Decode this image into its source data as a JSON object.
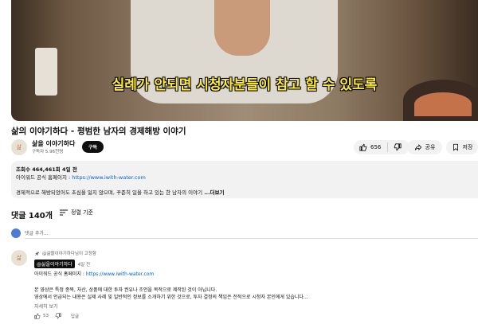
{
  "video": {
    "subtitle": "실례가 안되면 시청자분들이 참고 할 수 있도록"
  },
  "title": "삶의 이야기하다 - 평범한 남자의 경제해방 이야기",
  "channel": {
    "name": "삶을 이야기하다",
    "subscribers": "구독자 5.96천명",
    "subscribe_label": "구독",
    "avatar_text": "삶"
  },
  "actions": {
    "like_count": "656",
    "share_label": "공유",
    "save_label": "저장"
  },
  "description": {
    "stats": "조회수 464,461회  4일 전",
    "link_prefix": "아이워드 공식 홈페이지 : ",
    "link": "https://www.iwith-water.com",
    "summary": "경제적으로 해방되었어도 초심을 잃지 않으며, 꾸준히 일을 하고 있는 한 남자의 이야기",
    "more_label": "...더보기"
  },
  "comments": {
    "header": "댓글 140개",
    "sort_label": "정렬 기준",
    "add_placeholder": "댓글 추가...",
    "pinned": {
      "pinned_label": "@삶을이야기하다님이 고정함",
      "author": "@삶을이야기하다",
      "time": "4일 전",
      "link_label": "아이워드 공식 홈페이지 : ",
      "link": "https://www.iwith-water.com",
      "line1": "본 영상은 특정 종목, 자산, 상품에 대한 투자 권유나 조언을 목적으로 제작된 것이 아닙니다.",
      "line2": "영상에서 언급되는 내용은 실제 사례 및 일반적인 정보를 소개하기 위한 것으로, 투자 결정의 책임은 전적으로 시청자 본인에게 있습니다...",
      "more_label": "자세히 보기",
      "like_count": "53",
      "reply_label": "답글"
    }
  },
  "colors": {
    "subtitle": "#ffeb3b",
    "link": "#065fd4",
    "subscribe_bg": "#0f0f0f"
  }
}
